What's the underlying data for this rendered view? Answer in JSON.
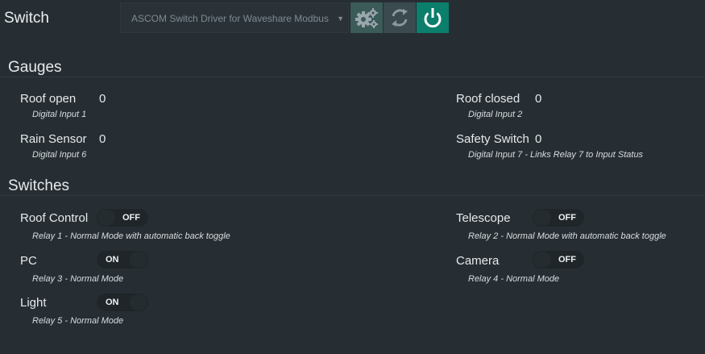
{
  "header": {
    "title": "Switch",
    "driver_select_value": "ASCOM Switch Driver for Waveshare Modbus R",
    "buttons": [
      {
        "icon": "gears-icon",
        "label": "Settings"
      },
      {
        "icon": "refresh-icon",
        "label": "Refresh"
      },
      {
        "icon": "power-icon",
        "label": "Connect"
      }
    ],
    "colors": {
      "accent": "#0b7e6c",
      "background": "#272e33"
    }
  },
  "gauges": {
    "title": "Gauges",
    "items": [
      {
        "label": "Roof open",
        "value": "0",
        "description": "Digital Input 1"
      },
      {
        "label": "Roof closed",
        "value": "0",
        "description": "Digital Input 2"
      },
      {
        "label": "Rain Sensor",
        "value": "0",
        "description": "Digital Input 6"
      },
      {
        "label": "Safety Switch",
        "value": "0",
        "description": "Digital Input 7 - Links Relay 7 to Input Status"
      }
    ]
  },
  "switches": {
    "title": "Switches",
    "items": [
      {
        "label": "Roof Control",
        "state": "OFF",
        "description": "Relay 1 - Normal Mode with automatic back toggle"
      },
      {
        "label": "Telescope",
        "state": "OFF",
        "description": "Relay 2 - Normal Mode with automatic back toggle"
      },
      {
        "label": "PC",
        "state": "ON",
        "description": "Relay 3 - Normal Mode"
      },
      {
        "label": "Camera",
        "state": "OFF",
        "description": "Relay 4 - Normal Mode"
      },
      {
        "label": "Light",
        "state": "ON",
        "description": "Relay 5 - Normal Mode"
      }
    ]
  }
}
